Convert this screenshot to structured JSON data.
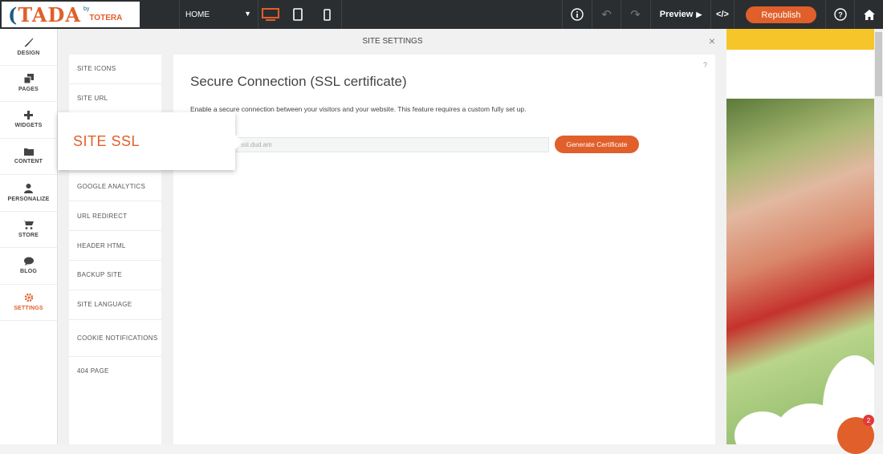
{
  "topbar": {
    "logo_main": "TADA",
    "logo_by": "by",
    "logo_brand": "TOTERA",
    "page_select": "HOME",
    "preview_label": "Preview",
    "republish_label": "Republish"
  },
  "sidebar": {
    "items": [
      {
        "label": "DESIGN",
        "icon": "brush-icon"
      },
      {
        "label": "PAGES",
        "icon": "pages-icon"
      },
      {
        "label": "WIDGETS",
        "icon": "plus-icon"
      },
      {
        "label": "CONTENT",
        "icon": "folder-icon"
      },
      {
        "label": "PERSONALIZE",
        "icon": "user-icon"
      },
      {
        "label": "STORE",
        "icon": "cart-icon"
      },
      {
        "label": "BLOG",
        "icon": "chat-icon"
      },
      {
        "label": "SETTINGS",
        "icon": "gear-icon"
      }
    ]
  },
  "panel": {
    "title": "SITE SETTINGS",
    "close": "×",
    "menu": [
      "SITE ICONS",
      "SITE URL",
      "GOOGLE ANALYTICS",
      "URL REDIRECT",
      "HEADER HTML",
      "BACKUP SITE",
      "SITE LANGUAGE",
      "COOKIE NOTIFICATIONS",
      "404 PAGE"
    ],
    "tooltip": "SITE SSL"
  },
  "content": {
    "help": "?",
    "heading": "Secure Connection (SSL certificate)",
    "description": "Enable a secure connection between your visitors and your website. This feature requires a custom fully set up.",
    "domain_value": "ssl.dud.am",
    "generate_label": "Generate Certificate"
  },
  "chat": {
    "badge": "2"
  },
  "colors": {
    "accent": "#e15f2a",
    "topbar": "#2b2e31",
    "logo_blue": "#1d5c86"
  }
}
